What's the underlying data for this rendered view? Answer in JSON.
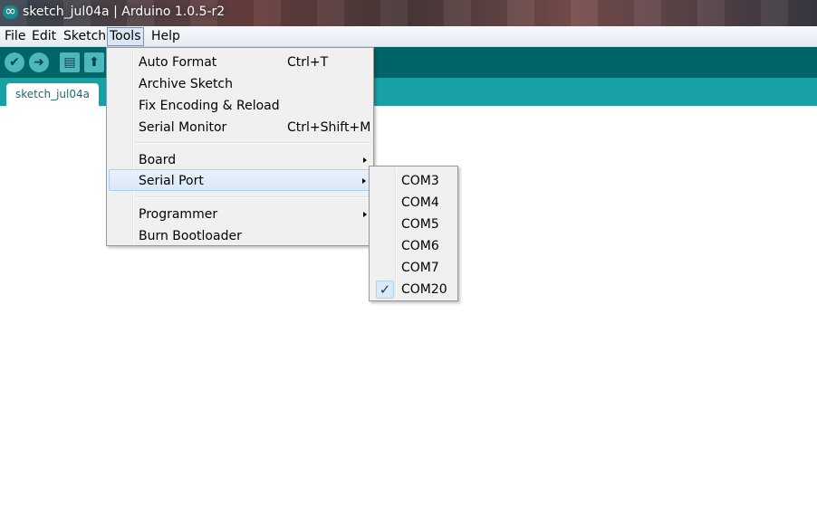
{
  "window": {
    "title": "sketch_jul04a | Arduino 1.0.5-r2",
    "icon": "arduino-logo-icon"
  },
  "menubar": {
    "items": [
      {
        "label": "File"
      },
      {
        "label": "Edit"
      },
      {
        "label": "Sketch"
      },
      {
        "label": "Tools",
        "active": true
      },
      {
        "label": "Help"
      }
    ]
  },
  "toolbar": {
    "buttons": [
      {
        "name": "verify",
        "glyph": "✔",
        "icon": "checkmark-icon"
      },
      {
        "name": "upload",
        "glyph": "➜",
        "icon": "arrow-right-icon"
      },
      {
        "name": "new",
        "glyph": "▤",
        "icon": "document-icon"
      },
      {
        "name": "open",
        "glyph": "⬆",
        "icon": "arrow-up-icon"
      }
    ]
  },
  "tabs": [
    {
      "label": "sketch_jul04a"
    }
  ],
  "tools_menu": {
    "items": [
      {
        "label": "Auto Format",
        "shortcut": "Ctrl+T"
      },
      {
        "label": "Archive Sketch",
        "shortcut": ""
      },
      {
        "label": "Fix Encoding & Reload",
        "shortcut": ""
      },
      {
        "label": "Serial Monitor",
        "shortcut": "Ctrl+Shift+M"
      },
      {
        "label": "Board",
        "submenu": true
      },
      {
        "label": "Serial Port",
        "submenu": true,
        "highlighted": true
      },
      {
        "label": "Programmer",
        "submenu": true
      },
      {
        "label": "Burn Bootloader",
        "shortcut": ""
      }
    ]
  },
  "serial_port_menu": {
    "items": [
      {
        "label": "COM3"
      },
      {
        "label": "COM4"
      },
      {
        "label": "COM5"
      },
      {
        "label": "COM6"
      },
      {
        "label": "COM7"
      },
      {
        "label": "COM20",
        "checked": true
      }
    ],
    "check_glyph": "✓"
  },
  "colors": {
    "toolbar": "#006468",
    "tabstrip": "#17a1a5"
  }
}
